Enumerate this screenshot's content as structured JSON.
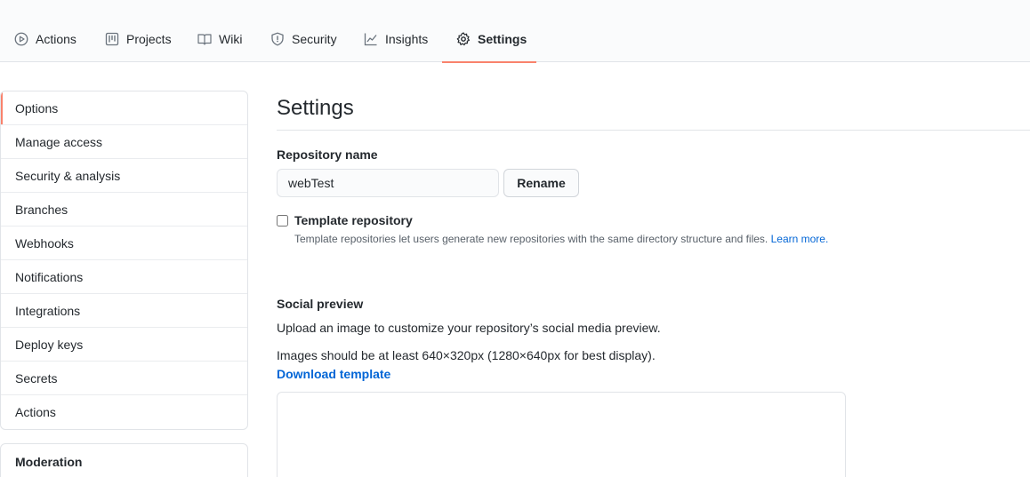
{
  "tabs": [
    {
      "label": "Actions",
      "icon": "play-icon"
    },
    {
      "label": "Projects",
      "icon": "project-board-icon"
    },
    {
      "label": "Wiki",
      "icon": "book-icon"
    },
    {
      "label": "Security",
      "icon": "shield-icon"
    },
    {
      "label": "Insights",
      "icon": "graph-icon"
    },
    {
      "label": "Settings",
      "icon": "gear-icon",
      "selected": true
    }
  ],
  "sidebar": {
    "items": [
      {
        "label": "Options",
        "selected": true
      },
      {
        "label": "Manage access"
      },
      {
        "label": "Security & analysis"
      },
      {
        "label": "Branches"
      },
      {
        "label": "Webhooks"
      },
      {
        "label": "Notifications"
      },
      {
        "label": "Integrations"
      },
      {
        "label": "Deploy keys"
      },
      {
        "label": "Secrets"
      },
      {
        "label": "Actions"
      }
    ],
    "moderation_heading": "Moderation"
  },
  "main": {
    "title": "Settings",
    "repo_name": {
      "label": "Repository name",
      "value": "webTest",
      "rename_button": "Rename"
    },
    "template": {
      "label": "Template repository",
      "checked": false,
      "note": "Template repositories let users generate new repositories with the same directory structure and files.",
      "learn_more": "Learn more."
    },
    "social_preview": {
      "heading": "Social preview",
      "description": "Upload an image to customize your repository’s social media preview.",
      "hint": "Images should be at least 640×320px (1280×640px for best display).",
      "download_link": "Download template"
    }
  },
  "colors": {
    "accent_underline": "#f9826c",
    "link": "#0366d6",
    "border": "#e1e4e8"
  }
}
